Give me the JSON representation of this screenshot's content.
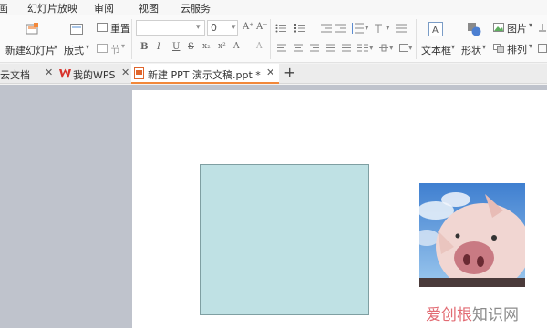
{
  "menu": [
    "画",
    "幻灯片放映",
    "审阅",
    "视图",
    "云服务"
  ],
  "ribbon": {
    "new_slide": "新建幻灯片",
    "layout": "版式",
    "reset": "重置",
    "section": "节",
    "font_size": "0",
    "textbox": "文本框",
    "shape": "形状",
    "picture": "图片",
    "arrange": "排列",
    "bold": "B",
    "italic": "I",
    "underline": "U",
    "strike": "S"
  },
  "tabs": [
    {
      "label": "云文档"
    },
    {
      "label": "我的WPS"
    },
    {
      "label": "新建 PPT 演示文稿.ppt *",
      "active": true
    }
  ],
  "new_tab": "+",
  "watermark": {
    "part1": "爱创根",
    "part2": "知识网"
  },
  "colors": {
    "accent": "#f2883a",
    "shape_fill": "#bfe1e4",
    "wps_red": "#d8322b"
  }
}
